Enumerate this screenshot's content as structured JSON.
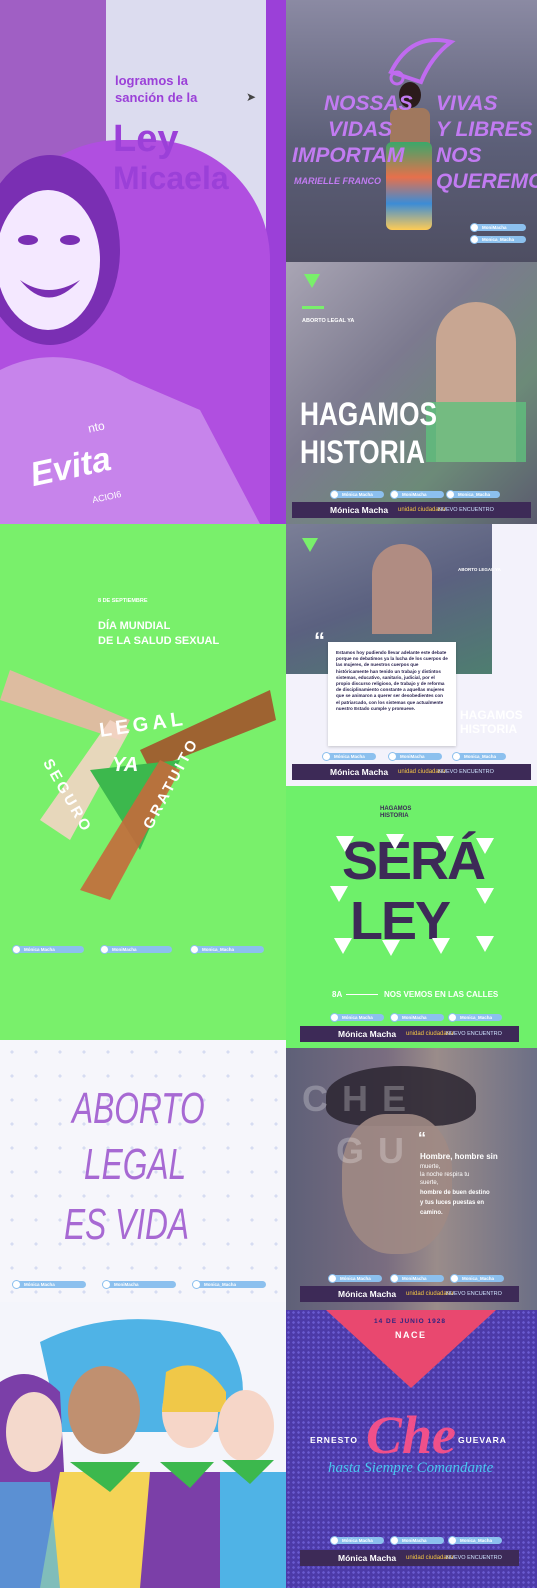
{
  "colors": {
    "purple": "#9b40d8",
    "lilac": "#a05fc4",
    "light_panel": "#dcdcef",
    "green": "#79f06b",
    "green2": "#6ef06a",
    "navy": "#3d2a57",
    "blue_pill": "#8cc0ee",
    "pink": "#e9486f"
  },
  "tile1": {
    "line1": "logramos la",
    "line2": "sanción de la",
    "title1": "Ley",
    "title2": "Micaela",
    "shirt1": "Evita",
    "shirt2": "nto",
    "shirt3": "ACIOI6"
  },
  "tile2": {
    "l1a": "NOSSAS",
    "l1b": "VIVAS",
    "l2a": "VIDAS",
    "l2b": "Y LIBRES",
    "l3a": "IMPORTAM",
    "l3b": "NOS",
    "l4a": "MARIELLE FRANCO",
    "l4b": "QUEREMOS"
  },
  "tile3": {
    "kicker": "ABORTO LEGAL YA",
    "title1": "HAGAMOS",
    "title2": "HISTORIA"
  },
  "tile4": {
    "date": "8 DE SEPTIEMBRE",
    "title1": "DÍA MUNDIAL",
    "title2": "DE LA SALUD SEXUAL",
    "word1": "LEGAL",
    "word2": "YA",
    "word3": "SEGURO",
    "word4": "GRATUITO"
  },
  "tile5": {
    "kicker": "ABORTO LEGAL YA",
    "quote_mark": "“",
    "quote": "Estamos hoy pudiendo llevar adelante este debate porque no debatimos ya la lucha de los cuerpos de las mujeres, de nuestros cuerpos que históricamente han tenido un trabajo y distintos sistemas, educativo, sanitario, judicial, por el propio discurso religioso, de trabajo y de reforma de disciplinamiento constante a aquellas mujeres que se animaron a querer ser desobedientes con el patriarcado, con los sistemas que actualmente nuestro Estado cumple y promueve.",
    "title1": "HAGAMOS",
    "title2": "HISTORIA"
  },
  "tile6": {
    "kicker1": "HAGAMOS",
    "kicker2": "HISTORIA",
    "title1": "SERÁ",
    "title2": "LEY",
    "footer_left": "8A",
    "footer_right": "NOS VEMOS EN LAS CALLES"
  },
  "tile7": {
    "line1": "ABORTO",
    "line2": "LEGAL",
    "line3": "ES VIDA"
  },
  "tile8": {
    "bg1": "CHE",
    "bg2": "GU",
    "quote_mark": "“",
    "q1": "Hombre, hombre sin",
    "q2": "muerte,",
    "q3": "la noche respira tu",
    "q4": "suerte,",
    "q5": "hombre de buen destino",
    "q6": "y tus luces puestas en",
    "q7": "camino."
  },
  "tile10": {
    "date": "14 DE JUNIO 1928",
    "born": "NACE",
    "first": "ERNESTO",
    "che": "Che",
    "last": "GUEVARA",
    "motto": "hasta Siempre Comandante"
  },
  "footer": {
    "name": "Mónica Macha",
    "facebook": "Mónica Macha",
    "twitter": "MoniMacha",
    "instagram": "Monica_Macha",
    "unidad": "unidad ciudadana",
    "nuevo": "NUEVO ENCUENTRO"
  }
}
